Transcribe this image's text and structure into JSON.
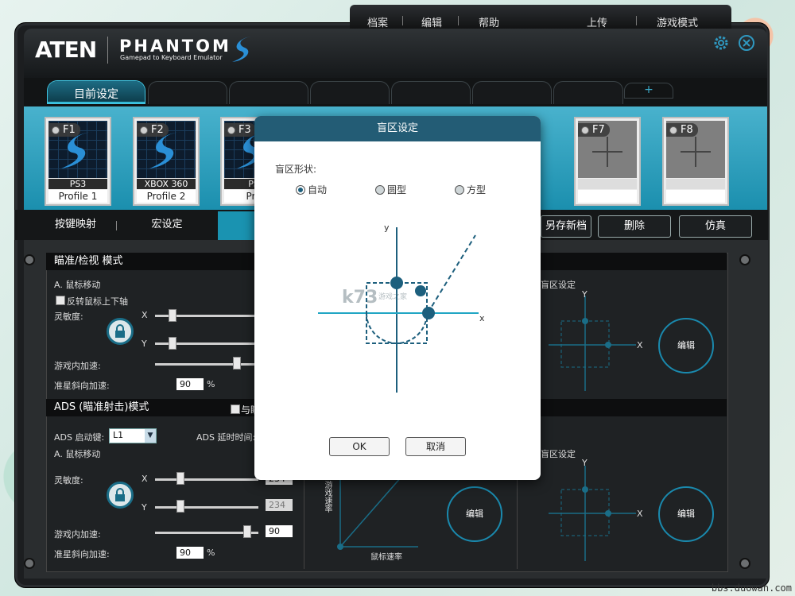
{
  "menu": {
    "left": [
      "档案",
      "编辑",
      "帮助"
    ],
    "right": [
      "上传",
      "游戏模式"
    ]
  },
  "brand": {
    "company": "ATEN",
    "product": "PHANTOM",
    "tagline": "Gamepad to Keyboard Emulator"
  },
  "tabs": {
    "current": "目前设定",
    "add": "+"
  },
  "profiles": [
    {
      "key": "F1",
      "platform": "PS3",
      "name": "Profile 1",
      "empty": false
    },
    {
      "key": "F2",
      "platform": "XBOX 360",
      "name": "Profile 2",
      "empty": false
    },
    {
      "key": "F3",
      "platform": "PS",
      "name": "Pro",
      "empty": false
    },
    {
      "key": "F7",
      "platform": "",
      "name": "",
      "empty": true
    },
    {
      "key": "F8",
      "platform": "",
      "name": "",
      "empty": true
    }
  ],
  "function_tabs": {
    "keymap": "按键映射",
    "macro": "宏设定",
    "save_as": "另存新档",
    "delete": "删除",
    "emulate": "仿真"
  },
  "aim_section": {
    "title": "瞄准/检视 模式",
    "mouse_move": "A. 鼠标移动",
    "invert_y": "反转鼠标上下轴",
    "sensitivity": "灵敏度:",
    "x": "X",
    "y": "Y",
    "ingame_accel": "游戏内加速:",
    "diag_accel": "准星斜向加速:",
    "diag_value": "90",
    "percent": "%",
    "deadzone_label": "盲区设定",
    "edit": "编辑"
  },
  "ads_section": {
    "title": "ADS (瞄准射击)模式",
    "sync": "与瞄",
    "trigger_label": "ADS 启动键:",
    "trigger_value": "L1",
    "delay_label": "ADS 延时时间:",
    "mouse_move": "A. 鼠标移动",
    "sensitivity": "灵敏度:",
    "x": "X",
    "y": "Y",
    "x_value": "234",
    "y_value": "234",
    "ingame_accel": "游戏内加速:",
    "ingame_value": "90",
    "diag_accel": "准星斜向加速:",
    "diag_value": "90",
    "percent": "%",
    "deadzone_label": "盲区设定",
    "edit": "编辑",
    "graph_ylabel": "游戏速率",
    "graph_xlabel": "鼠标速率"
  },
  "dialog": {
    "title": "盲区设定",
    "shape_label": "盲区形状:",
    "options": [
      "自动",
      "圆型",
      "方型"
    ],
    "selected": "自动",
    "axis_x": "x",
    "axis_y": "y",
    "ok": "OK",
    "cancel": "取消"
  },
  "watermark": {
    "site": "k73",
    "site_sub": "游戏之家",
    "corner": "bbs.duowan.com"
  },
  "colors": {
    "accent": "#1a93b1",
    "dialog_title": "#235c75",
    "window_bg": "#1c1e20"
  }
}
